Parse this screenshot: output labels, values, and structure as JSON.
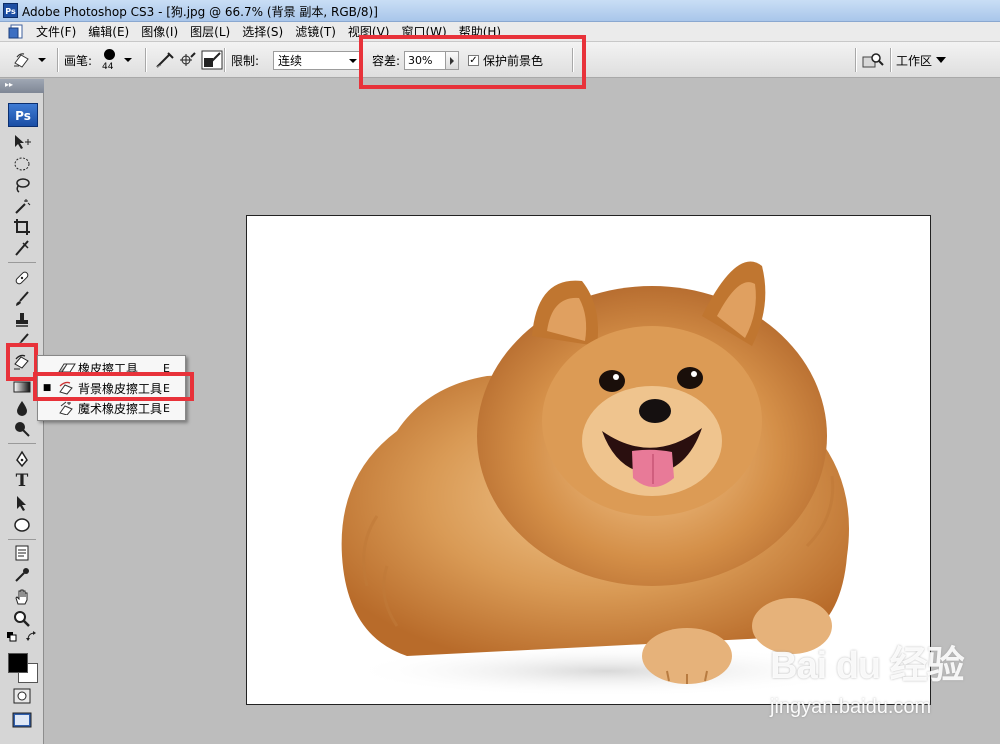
{
  "window": {
    "logo_text": "Ps",
    "title": "Adobe Photoshop CS3 - [狗.jpg @ 66.7% (背景 副本, RGB/8)]"
  },
  "menu": [
    "文件(F)",
    "编辑(E)",
    "图像(I)",
    "图层(L)",
    "选择(S)",
    "滤镜(T)",
    "视图(V)",
    "窗口(W)",
    "帮助(H)"
  ],
  "options": {
    "brush_label": "画笔:",
    "brush_size": "44",
    "limit_label": "限制:",
    "limit_value": "连续",
    "tolerance_label": "容差:",
    "tolerance_value": "30%",
    "protect_label": "保护前景色",
    "protect_checked": "✓",
    "workspace_label": "工作区"
  },
  "toolbox": {
    "logo_text": "Ps",
    "tools": [
      "move-tool",
      "marquee-tool",
      "lasso-tool",
      "magic-wand-tool",
      "crop-tool",
      "slice-tool",
      "healing-brush-tool",
      "brush-tool",
      "clone-stamp-tool",
      "history-brush-tool",
      "eraser-tool",
      "gradient-tool",
      "blur-tool",
      "dodge-tool",
      "pen-tool",
      "type-tool",
      "path-selection-tool",
      "shape-tool",
      "notes-tool",
      "eyedropper-tool",
      "hand-tool",
      "zoom-tool"
    ],
    "type_tool_label": "T"
  },
  "flyout": {
    "items": [
      {
        "label": "橡皮擦工具",
        "key": "E",
        "selected": false
      },
      {
        "label": "背景橡皮擦工具",
        "key": "E",
        "selected": true
      },
      {
        "label": "魔术橡皮擦工具",
        "key": "E",
        "selected": false
      }
    ]
  },
  "colors": {
    "highlight": "#e8323a",
    "foreground": "#000000",
    "background": "#ffffff",
    "canvas_bg": "#bdbdbd",
    "dog_fur": "#c9833f"
  },
  "watermark": {
    "logo": "Bai du 经验",
    "url": "jingyan.baidu.com"
  }
}
